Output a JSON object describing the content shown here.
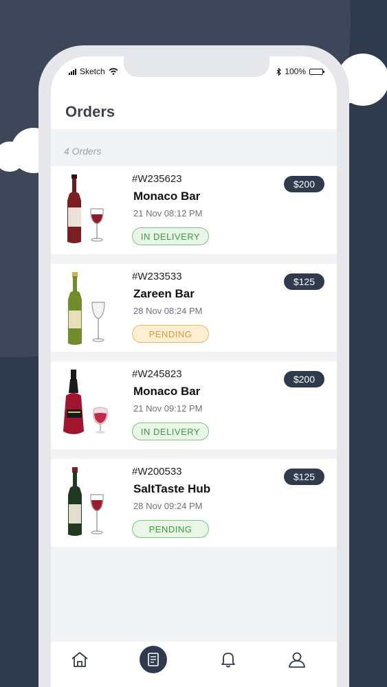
{
  "status_bar": {
    "carrier": "Sketch",
    "battery": "100%"
  },
  "header": {
    "title": "Orders"
  },
  "orders_count": "4 Orders",
  "orders": [
    {
      "id": "#W235623",
      "name": "Monaco Bar",
      "date": "21 Nov 08:12 PM",
      "price": "$200",
      "status": "IN DELIVERY"
    },
    {
      "id": "#W233533",
      "name": "Zareen Bar",
      "date": "28 Nov 08:24 PM",
      "price": "$125",
      "status": "PENDING"
    },
    {
      "id": "#W245823",
      "name": "Monaco Bar",
      "date": "21 Nov 09:12 PM",
      "price": "$200",
      "status": "IN DELIVERY"
    },
    {
      "id": "#W200533",
      "name": "SaltTaste Hub",
      "date": "28 Nov 09:24 PM",
      "price": "$125",
      "status": "PENDING"
    }
  ],
  "tabs": [
    {
      "icon": "home-icon",
      "active": false
    },
    {
      "icon": "receipt-icon",
      "active": true
    },
    {
      "icon": "bell-icon",
      "active": false
    },
    {
      "icon": "user-icon",
      "active": false
    }
  ],
  "colors": {
    "navy": "#2f3a4d",
    "green_status": "#3f9a3f",
    "orange_status": "#d69a34"
  }
}
